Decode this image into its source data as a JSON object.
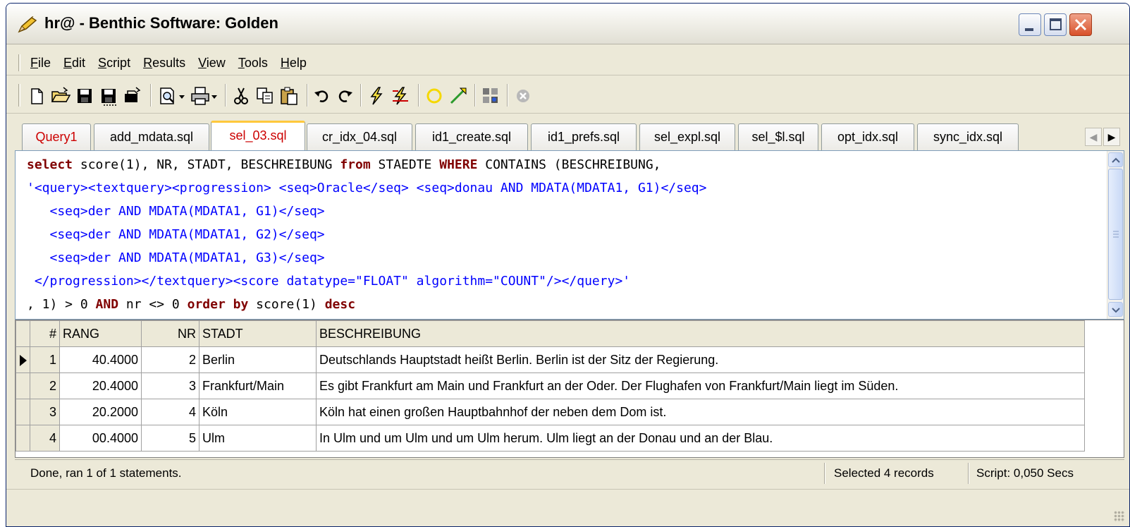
{
  "window": {
    "title": "hr@ - Benthic Software: Golden"
  },
  "menu": [
    {
      "accel": "F",
      "rest": "ile"
    },
    {
      "accel": "E",
      "rest": "dit"
    },
    {
      "accel": "S",
      "rest": "cript"
    },
    {
      "accel": "R",
      "rest": "esults"
    },
    {
      "accel": "V",
      "rest": "iew"
    },
    {
      "accel": "T",
      "rest": "ools"
    },
    {
      "accel": "H",
      "rest": "elp"
    }
  ],
  "toolbar_icons": [
    "new-file-icon",
    "open-folder-icon",
    "save-icon",
    "save-all-icon",
    "open-icon",
    "print-preview-icon",
    "print-icon",
    "cut-icon",
    "copy-icon",
    "paste-icon",
    "undo-icon",
    "redo-icon",
    "execute-icon",
    "execute-script-icon",
    "commit-icon",
    "rollback-icon",
    "explain-icon",
    "cancel-icon"
  ],
  "tabs": [
    "Query1",
    "add_mdata.sql",
    "sel_03.sql",
    "cr_idx_04.sql",
    "id1_create.sql",
    "id1_prefs.sql",
    "sel_expl.sql",
    "sel_$l.sql",
    "opt_idx.sql",
    "sync_idx.sql"
  ],
  "active_tab": "sel_03.sql",
  "editor": {
    "l1_kw1": "select",
    "l1_a": " score(1), NR, STADT, BESCHREIBUNG ",
    "l1_kw2": "from",
    "l1_b": " STAEDTE ",
    "l1_kw3": "WHERE",
    "l1_c": " CONTAINS (BESCHREIBUNG,",
    "l2": "'<query><textquery><progression> <seq>Oracle</seq> <seq>donau AND MDATA(MDATA1, G1)</seq>",
    "l3": "   <seq>der AND MDATA(MDATA1, G1)</seq>",
    "l4": "   <seq>der AND MDATA(MDATA1, G2)</seq>",
    "l5": "   <seq>der AND MDATA(MDATA1, G3)</seq>",
    "l6": " </progression></textquery><score datatype=\"FLOAT\" algorithm=\"COUNT\"/></query>'",
    "l7_a": ", 1) > 0 ",
    "l7_kw1": "AND",
    "l7_b": " nr <> 0 ",
    "l7_kw2": "order by",
    "l7_c": " score(1) ",
    "l7_kw3": "desc"
  },
  "grid": {
    "headers": {
      "num": "#",
      "rang": "RANG",
      "nr": "NR",
      "stadt": "STADT",
      "beschreibung": "BESCHREIBUNG"
    },
    "rows": [
      {
        "num": "1",
        "rang": "40.4000",
        "nr": "2",
        "stadt": "Berlin",
        "beschreibung": "Deutschlands Hauptstadt heißt Berlin. Berlin ist der Sitz der Regierung."
      },
      {
        "num": "2",
        "rang": "20.4000",
        "nr": "3",
        "stadt": "Frankfurt/Main",
        "beschreibung": "Es gibt Frankfurt am Main und Frankfurt an der Oder. Der Flughafen von Frankfurt/Main liegt im Süden."
      },
      {
        "num": "3",
        "rang": "20.2000",
        "nr": "4",
        "stadt": "Köln",
        "beschreibung": "Köln hat einen großen Hauptbahnhof der neben dem Dom ist."
      },
      {
        "num": "4",
        "rang": "00.4000",
        "nr": "5",
        "stadt": "Ulm",
        "beschreibung": "In Ulm und um Ulm und um Ulm herum. Ulm liegt an der Donau und an der Blau."
      }
    ]
  },
  "status": {
    "message": "Done, ran 1 of 1 statements.",
    "records": "Selected 4 records",
    "time": "Script: 0,050 Secs"
  }
}
